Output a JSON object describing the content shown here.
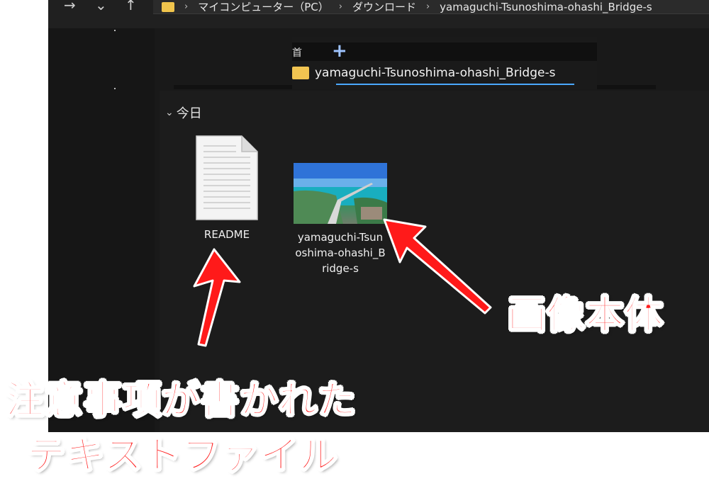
{
  "window": {
    "nav": {
      "forward_glyph": "→",
      "down_glyph": "⌄",
      "up_glyph": "↑"
    },
    "breadcrumb": [
      "マイコンピューター（PC）",
      "ダウンロード",
      "yamaguchi-Tsunoshima-ohashi_Bridge-s"
    ],
    "sidebar_fragment": "PC"
  },
  "tab_preview": {
    "head_text": "首",
    "add_glyph": "+",
    "folder_name": "yamaguchi-Tsunoshima-ohashi_Bridge-s"
  },
  "content": {
    "group_label": "今日",
    "files": [
      {
        "name": "README",
        "type": "text-document"
      },
      {
        "name_lines": [
          "yamaguchi-Tsun",
          "oshima-ohashi_B",
          "ridge-s"
        ],
        "type": "image"
      }
    ]
  },
  "annotations": {
    "image_label": "画像本体",
    "text_file_label_line1": "注意事項が書かれた",
    "text_file_label_line2": "テキストファイル"
  },
  "colors": {
    "accent_red": "#ff1a1a",
    "folder_yellow": "#f1c451",
    "explorer_bg": "#191919",
    "underline_blue": "#4aa8ff"
  }
}
